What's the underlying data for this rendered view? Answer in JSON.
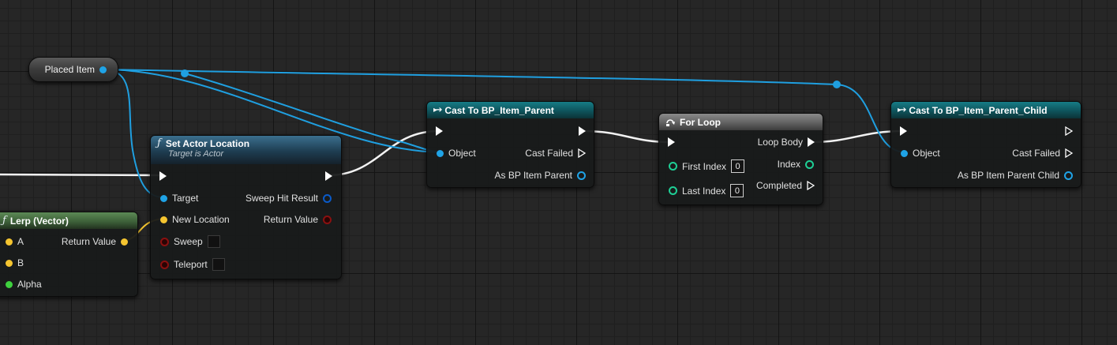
{
  "colors": {
    "object": "#1fa3e6",
    "vector": "#f5c530",
    "bool": "#8a1010",
    "float": "#3ed13e",
    "struct": "#0a5ac8",
    "exec": "#ffffff"
  },
  "variable_node": {
    "label": "Placed Item"
  },
  "set_actor_location": {
    "title": "Set Actor Location",
    "subtitle": "Target is Actor",
    "pins": {
      "target": "Target",
      "new_location": "New Location",
      "sweep": "Sweep",
      "teleport": "Teleport",
      "sweep_hit_result": "Sweep Hit Result",
      "return_value": "Return Value"
    }
  },
  "lerp": {
    "title": "Lerp (Vector)",
    "pins": {
      "a": "A",
      "b": "B",
      "alpha": "Alpha",
      "return_value": "Return Value"
    }
  },
  "cast_parent": {
    "title": "Cast To BP_Item_Parent",
    "pins": {
      "object": "Object",
      "cast_failed": "Cast Failed",
      "as": "As BP Item Parent"
    }
  },
  "for_loop": {
    "title": "For Loop",
    "pins": {
      "first_index": "First Index",
      "first_index_value": "0",
      "last_index": "Last Index",
      "last_index_value": "0",
      "loop_body": "Loop Body",
      "index": "Index",
      "completed": "Completed"
    }
  },
  "cast_child": {
    "title": "Cast To BP_Item_Parent_Child",
    "pins": {
      "object": "Object",
      "cast_failed": "Cast Failed",
      "as": "As BP Item Parent Child"
    }
  }
}
